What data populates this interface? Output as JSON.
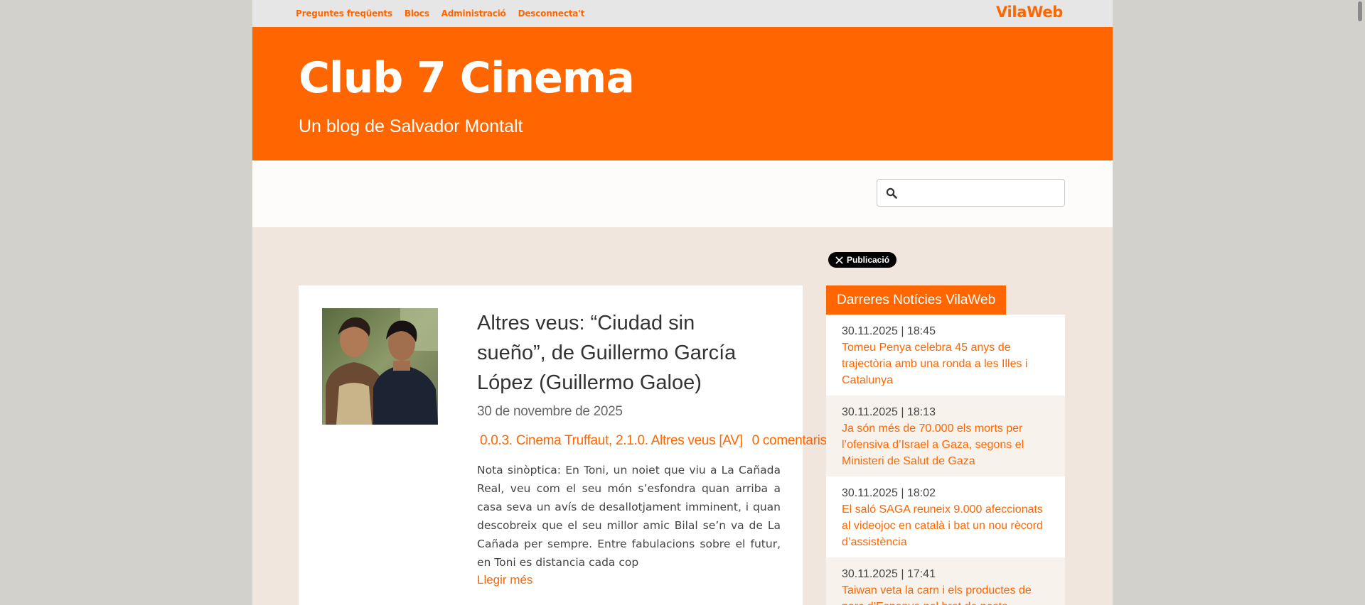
{
  "topnav": {
    "items": [
      "Preguntes freqüents",
      "Blocs",
      "Administració",
      "Desconnecta't"
    ],
    "brand": "VilaWeb"
  },
  "header": {
    "title": "Club 7 Cinema",
    "subtitle": "Un blog de Salvador Montalt"
  },
  "search": {
    "placeholder": "",
    "icon": "search-icon"
  },
  "share": {
    "label": "Publicació",
    "icon": "x-logo-icon"
  },
  "post": {
    "title": "Altres veus: “Ciudad sin sueño”, de Guillermo García López (Guillermo Galoe)",
    "date": "30 de novembre de 2025",
    "categories": "0.0.3. Cinema Truffaut, 2.1.0. Altres veus [AV]",
    "comments": "0 comentaris",
    "excerpt": "Nota sinòptica: En Toni, un noiet que viu a La Cañada Real, veu com el seu món s’esfondra quan arriba a casa seva un avís de desallotjament imminent, i quan descobreix que el seu millor amic Bilal se’n va de La Cañada per sempre. Entre fabulacions sobre el futur, en Toni es distancia cada cop",
    "read_more": "Llegir més"
  },
  "news": {
    "heading": "Darreres Notícies VilaWeb",
    "items": [
      {
        "time": "30.11.2025 | 18:45",
        "title": "Tomeu Penya celebra 45 anys de trajectòria amb una ronda a les Illes i Catalunya"
      },
      {
        "time": "30.11.2025 | 18:13",
        "title": "Ja són més de 70.000 els morts per l’ofensiva d’Israel a Gaza, segons el Ministeri de Salut de Gaza"
      },
      {
        "time": "30.11.2025 | 18:02",
        "title": "El saló SAGA reuneix 9.000 afeccionats al videojoc en català i bat un nou rècord d’assistència"
      },
      {
        "time": "30.11.2025 | 17:41",
        "title": "Taiwan veta la carn i els productes de porc d’Espanya pel brot de pesta"
      }
    ]
  },
  "colors": {
    "accent": "#ff6600",
    "page_bg": "#f0e6dd",
    "outer_bg": "#d2d1cc"
  }
}
